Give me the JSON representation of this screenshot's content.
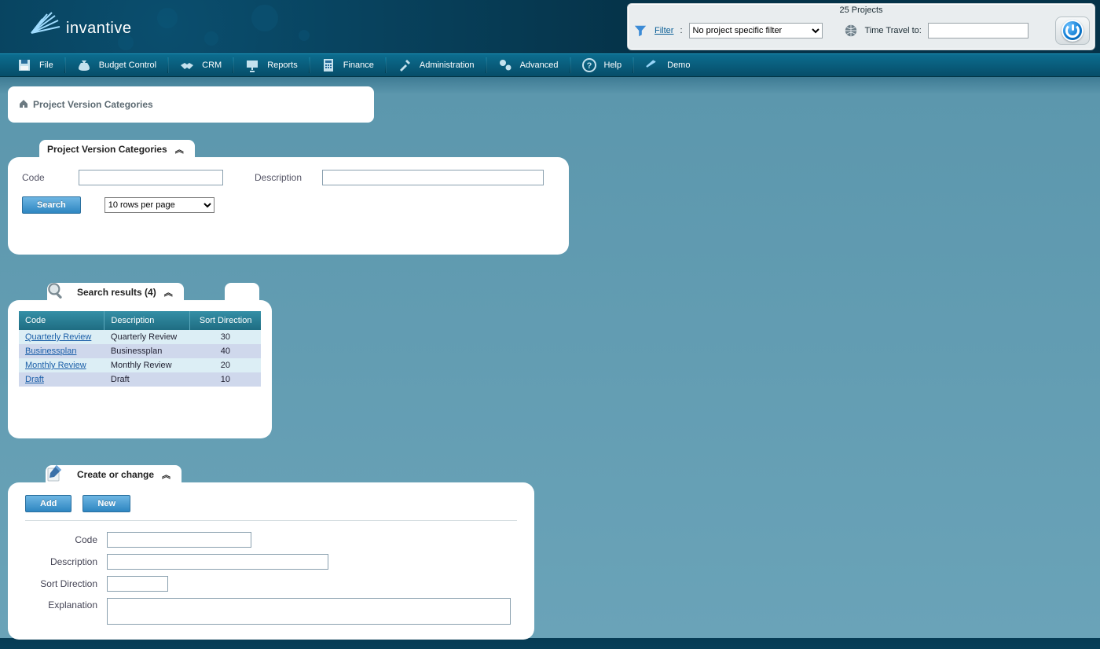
{
  "brand": "invantive",
  "topbar": {
    "title": "25 Projects",
    "filter_label": "Filter",
    "filter_sep": ":",
    "filter_selected": "No project specific filter",
    "timetravel_label": "Time Travel to:",
    "timetravel_value": ""
  },
  "menu": [
    {
      "id": "file",
      "label": "File"
    },
    {
      "id": "budget",
      "label": "Budget Control"
    },
    {
      "id": "crm",
      "label": "CRM"
    },
    {
      "id": "reports",
      "label": "Reports"
    },
    {
      "id": "finance",
      "label": "Finance"
    },
    {
      "id": "admin",
      "label": "Administration"
    },
    {
      "id": "advanced",
      "label": "Advanced"
    },
    {
      "id": "help",
      "label": "Help"
    },
    {
      "id": "demo",
      "label": "Demo"
    }
  ],
  "breadcrumb": "Project Version Categories",
  "search_panel": {
    "title": "Project Version Categories",
    "code_label": "Code",
    "code_value": "",
    "desc_label": "Description",
    "desc_value": "",
    "search_btn": "Search",
    "rows_selected": "10 rows per page"
  },
  "results_panel": {
    "title": "Search results (4)",
    "columns": [
      "Code",
      "Description",
      "Sort Direction"
    ],
    "rows": [
      {
        "code": "Quarterly Review",
        "desc": "Quarterly Review",
        "sort": "30"
      },
      {
        "code": "Businessplan",
        "desc": "Businessplan",
        "sort": "40"
      },
      {
        "code": "Monthly Review",
        "desc": "Monthly Review",
        "sort": "20"
      },
      {
        "code": "Draft",
        "desc": "Draft",
        "sort": "10"
      }
    ]
  },
  "create_panel": {
    "title": "Create or change",
    "add_btn": "Add",
    "new_btn": "New",
    "code_label": "Code",
    "desc_label": "Description",
    "sort_label": "Sort Direction",
    "expl_label": "Explanation",
    "code_value": "",
    "desc_value": "",
    "sort_value": "",
    "expl_value": ""
  }
}
